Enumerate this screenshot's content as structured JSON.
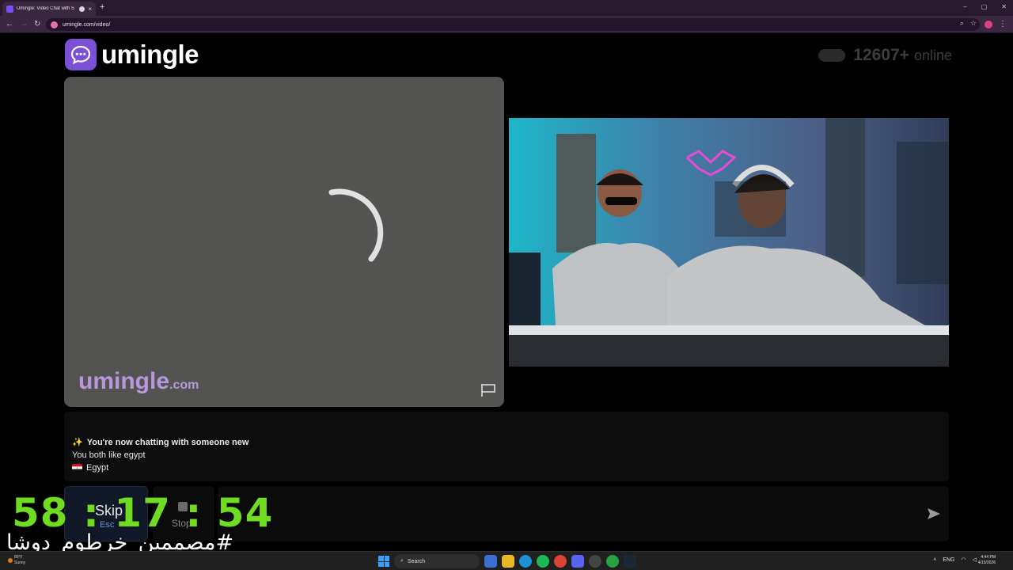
{
  "browser": {
    "tab_title": "Umingle: Video Chat with S",
    "new_tab_symbol": "+",
    "close_symbol": "×",
    "url": "umingle.com/video/",
    "window_controls": [
      "–",
      "▢",
      "✕"
    ]
  },
  "header": {
    "logo_text": "umingle",
    "online_count": "12607+",
    "online_label": "online"
  },
  "remote_video": {
    "watermark": "umingle",
    "watermark_domain": ".com",
    "status": "loading"
  },
  "chat": {
    "sparkle": "✨",
    "new_chat_message": "You're now chatting with someone new",
    "common_interest": "You both like egypt",
    "country": "Egypt"
  },
  "controls": {
    "skip_label": "Skip",
    "skip_key": "Esc",
    "stop_label": "Stop",
    "message_placeholder": "",
    "send_icon": "send-icon"
  },
  "overlay": {
    "timer": "58 : 17 : 54",
    "hashtag": "#مصممين_خرطوم_دوشا"
  },
  "taskbar": {
    "weather_temp": "89°F",
    "weather_cond": "Sunny",
    "search_label": "Search",
    "language": "ENG",
    "time": "4:44 PM",
    "date": "4/15/2026"
  },
  "colors": {
    "brand_purple": "#7b4fd6",
    "watermark_purple": "#b897dd",
    "timer_green": "#6fdc21",
    "browser_chrome": "#3a2840"
  }
}
